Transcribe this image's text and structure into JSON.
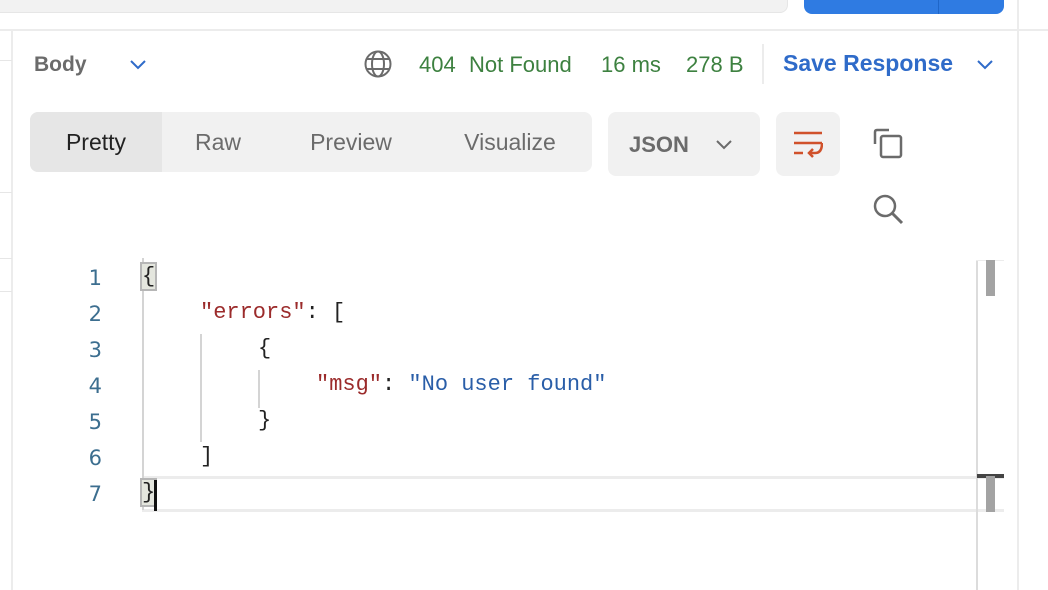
{
  "response": {
    "section_label": "Body",
    "status_code": "404",
    "status_text": "Not Found",
    "time": "16 ms",
    "size": "278 B",
    "save_label": "Save Response"
  },
  "view_tabs": [
    {
      "label": "Pretty",
      "active": true
    },
    {
      "label": "Raw",
      "active": false
    },
    {
      "label": "Preview",
      "active": false
    },
    {
      "label": "Visualize",
      "active": false
    }
  ],
  "format": {
    "selected": "JSON"
  },
  "colors": {
    "status_green": "#3d8140",
    "accent_blue": "#2f6bc9",
    "send_blue": "#2f7be2",
    "wrap_icon_orange": "#d0512b",
    "json_key": "#9b2b2b",
    "json_string": "#2a5ea8",
    "line_number": "#3c6e8f"
  },
  "editor": {
    "line_numbers": [
      "1",
      "2",
      "3",
      "4",
      "5",
      "6",
      "7"
    ],
    "lines": {
      "l1": "{",
      "l2_key": "\"errors\"",
      "l2_rest": ": [",
      "l3": "{",
      "l4_key": "\"msg\"",
      "l4_colon": ": ",
      "l4_value": "\"No user found\"",
      "l5": "}",
      "l6": "]",
      "l7": "}"
    }
  }
}
